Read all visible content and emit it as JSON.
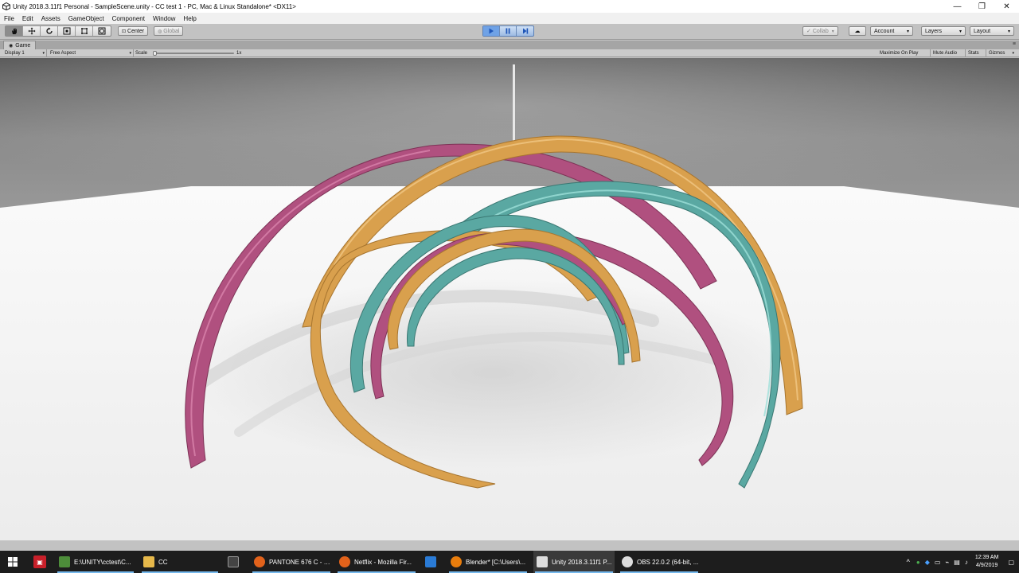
{
  "window": {
    "title": "Unity 2018.3.11f1 Personal - SampleScene.unity - CC test 1 - PC, Mac & Linux Standalone* <DX11>",
    "minimize_glyph": "—",
    "maximize_glyph": "❐",
    "close_glyph": "✕"
  },
  "menu": [
    "File",
    "Edit",
    "Assets",
    "GameObject",
    "Component",
    "Window",
    "Help"
  ],
  "toolbar": {
    "tools": [
      "hand-tool",
      "move-tool",
      "rotate-tool",
      "scale-tool",
      "rect-tool",
      "transform-tool"
    ],
    "pivot_label": "Center",
    "space_label": "Global",
    "play_state": "playing",
    "collab_label": "Collab",
    "account_label": "Account",
    "layers_label": "Layers",
    "layout_label": "Layout"
  },
  "game_view": {
    "tab_label": "Game",
    "display_label": "Display 1",
    "aspect_label": "Free Aspect",
    "scale_label": "Scale",
    "scale_value": "1x",
    "maximize_label": "Maximize On Play",
    "mute_label": "Mute Audio",
    "stats_label": "Stats",
    "gizmos_label": "Gizmos"
  },
  "scene": {
    "ribbon_colors": {
      "magenta": "#b0507f",
      "gold": "#d9a04d",
      "teal": "#5aa8a2"
    },
    "floor_color": "#f3f3f3",
    "wall_color": "#727272"
  },
  "taskbar": {
    "apps": [
      {
        "label": "E:\\UNITY\\cctest\\C...",
        "color": "#4d8d3a",
        "active": false
      },
      {
        "label": "CC",
        "color": "#e6b84a",
        "active": false
      },
      {
        "label": "",
        "color": "#444444",
        "active": false
      },
      {
        "label": "PANTONE 676 C - F...",
        "color": "#e2621b",
        "active": false
      },
      {
        "label": "Netflix - Mozilla Fir...",
        "color": "#e2621b",
        "active": false
      },
      {
        "label": "",
        "color": "#2a7bd6",
        "active": false
      },
      {
        "label": "Blender* [C:\\Users\\...",
        "color": "#e87d0d",
        "active": false
      },
      {
        "label": "Unity 2018.3.11f1 P...",
        "color": "#dddddd",
        "active": true
      },
      {
        "label": "OBS 22.0.2 (64-bit, ...",
        "color": "#dddddd",
        "active": false
      }
    ],
    "time": "12:39 AM",
    "date": "4/9/2019"
  }
}
